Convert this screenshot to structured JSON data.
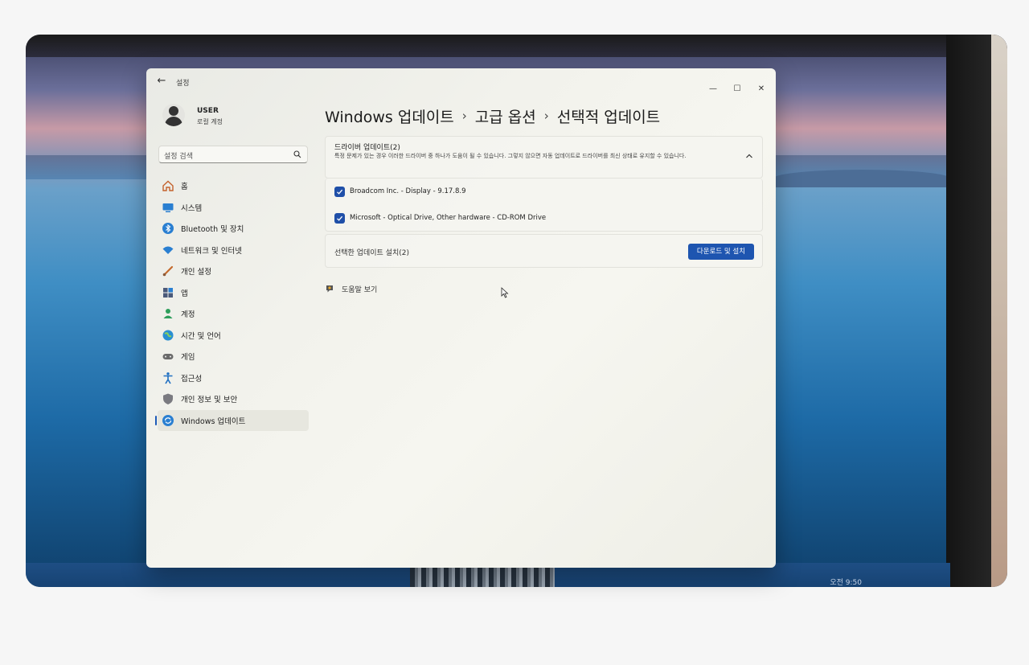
{
  "window": {
    "app_title": "설정",
    "back_glyph": "←",
    "controls": {
      "minimize": "—",
      "maximize": "☐",
      "close": "✕"
    }
  },
  "user": {
    "name": "USER",
    "account_type": "로컬 계정"
  },
  "search": {
    "placeholder": "설정 검색"
  },
  "sidebar": {
    "items": [
      {
        "label": "홈",
        "icon": "home-icon"
      },
      {
        "label": "시스템",
        "icon": "system-icon"
      },
      {
        "label": "Bluetooth 및 장치",
        "icon": "bluetooth-icon"
      },
      {
        "label": "네트워크 및 인터넷",
        "icon": "network-icon"
      },
      {
        "label": "개인 설정",
        "icon": "brush-icon"
      },
      {
        "label": "앱",
        "icon": "apps-icon"
      },
      {
        "label": "계정",
        "icon": "account-icon"
      },
      {
        "label": "시간 및 언어",
        "icon": "globe-icon"
      },
      {
        "label": "게임",
        "icon": "gamepad-icon"
      },
      {
        "label": "접근성",
        "icon": "accessibility-icon"
      },
      {
        "label": "개인 정보 및 보안",
        "icon": "shield-icon"
      },
      {
        "label": "Windows 업데이트",
        "icon": "update-icon",
        "active": true
      }
    ]
  },
  "breadcrumb": {
    "items": [
      "Windows 업데이트",
      "고급 옵션",
      "선택적 업데이트"
    ],
    "separator": "›"
  },
  "driver_updates": {
    "title": "드라이버 업데이트(2)",
    "description": "특정 문제가 있는 경우 이러한 드라이버 중 하나가 도움이 될 수 있습니다. 그렇지 않으면 자동 업데이트로 드라이버를 최신 상태로 유지할 수 있습니다.",
    "items": [
      {
        "label": "Broadcom Inc. - Display - 9.17.8.9",
        "checked": true
      },
      {
        "label": "Microsoft - Optical Drive, Other hardware - CD-ROM Drive",
        "checked": true
      }
    ]
  },
  "install": {
    "label": "선택한 업데이트 설치(2)",
    "button": "다운로드 및 설치"
  },
  "help": {
    "label": "도움말 보기"
  },
  "taskbar": {
    "clock": "오전 9:50"
  },
  "colors": {
    "accent": "#1e55b0",
    "checkbox": "#1f4fa8"
  }
}
